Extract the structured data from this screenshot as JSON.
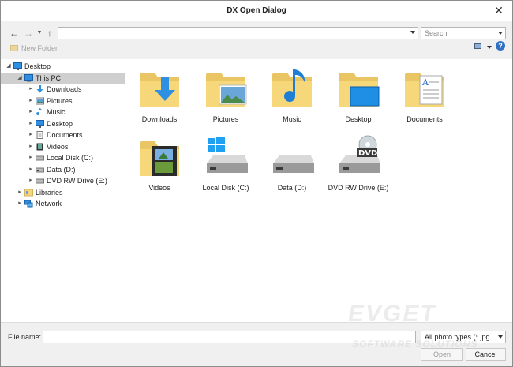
{
  "window": {
    "title": "DX Open Dialog"
  },
  "toolbar": {
    "search_placeholder": "Search",
    "new_folder_label": "New Folder"
  },
  "tree": [
    {
      "label": "Desktop",
      "icon": "desktop-icon",
      "level": 0,
      "expanded": true,
      "selected": false
    },
    {
      "label": "This PC",
      "icon": "pc-icon",
      "level": 1,
      "expanded": true,
      "selected": true
    },
    {
      "label": "Downloads",
      "icon": "downloads-icon",
      "level": 2,
      "expanded": false,
      "selected": false
    },
    {
      "label": "Pictures",
      "icon": "pictures-icon",
      "level": 2,
      "expanded": false,
      "selected": false
    },
    {
      "label": "Music",
      "icon": "music-icon",
      "level": 2,
      "expanded": false,
      "selected": false
    },
    {
      "label": "Desktop",
      "icon": "desktop-icon",
      "level": 2,
      "expanded": false,
      "selected": false
    },
    {
      "label": "Documents",
      "icon": "documents-icon",
      "level": 2,
      "expanded": false,
      "selected": false
    },
    {
      "label": "Videos",
      "icon": "videos-icon",
      "level": 2,
      "expanded": false,
      "selected": false
    },
    {
      "label": "Local Disk (C:)",
      "icon": "drive-icon",
      "level": 2,
      "expanded": false,
      "selected": false
    },
    {
      "label": "Data (D:)",
      "icon": "drive-icon",
      "level": 2,
      "expanded": false,
      "selected": false
    },
    {
      "label": "DVD RW Drive (E:)",
      "icon": "dvd-drive-icon",
      "level": 2,
      "expanded": false,
      "selected": false
    },
    {
      "label": "Libraries",
      "icon": "libraries-icon",
      "level": 1,
      "expanded": false,
      "selected": false
    },
    {
      "label": "Network",
      "icon": "network-icon",
      "level": 1,
      "expanded": false,
      "selected": false
    }
  ],
  "items": [
    {
      "label": "Downloads",
      "icon": "downloads-folder-icon"
    },
    {
      "label": "Pictures",
      "icon": "pictures-folder-icon"
    },
    {
      "label": "Music",
      "icon": "music-folder-icon"
    },
    {
      "label": "Desktop",
      "icon": "desktop-folder-icon"
    },
    {
      "label": "Documents",
      "icon": "documents-folder-icon"
    },
    {
      "label": "Videos",
      "icon": "videos-folder-icon"
    },
    {
      "label": "Local Disk (C:)",
      "icon": "windows-drive-icon"
    },
    {
      "label": "Data (D:)",
      "icon": "drive-icon"
    },
    {
      "label": "DVD RW Drive (E:)",
      "icon": "dvd-drive-icon"
    }
  ],
  "footer": {
    "file_name_label": "File name:",
    "file_name_value": "",
    "file_type": "All photo types (*.jpg...",
    "open_label": "Open",
    "cancel_label": "Cancel"
  },
  "watermark": {
    "line1": "EVGET",
    "line2": "SOFTWARE SOLUTIONS"
  },
  "colors": {
    "folder": "#f6d77a",
    "accent": "#2f8fe0",
    "selection": "#cfcfcf"
  }
}
